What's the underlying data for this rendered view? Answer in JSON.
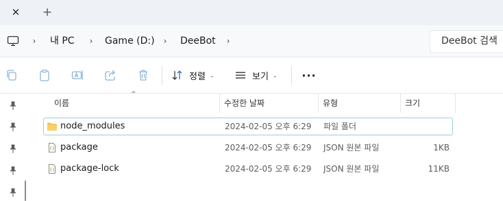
{
  "tabs": {
    "close_glyph": "✕",
    "new_tab_glyph": "+"
  },
  "address": {
    "breadcrumbs": [
      {
        "label": "내 PC"
      },
      {
        "label": "Game (D:)"
      },
      {
        "label": "DeeBot"
      }
    ],
    "separator_glyph": "›",
    "search_placeholder": "DeeBot 검색"
  },
  "toolbar": {
    "sort_label": "정렬",
    "view_label": "보기",
    "caret_glyph": "⌄",
    "more_glyph": "···"
  },
  "columns": {
    "name": "이름",
    "modified": "수정한 날짜",
    "type": "유형",
    "size": "크기"
  },
  "files": [
    {
      "name": "node_modules",
      "modified": "2024-02-05 오후 6:29",
      "type": "파일 폴더",
      "size": "",
      "icon": "folder-icon",
      "selected": true
    },
    {
      "name": "package",
      "modified": "2024-02-05 오후 6:29",
      "type": "JSON 원본 파일",
      "size": "1KB",
      "icon": "json-file-icon",
      "selected": false
    },
    {
      "name": "package-lock",
      "modified": "2024-02-05 오후 6:29",
      "type": "JSON 원본 파일",
      "size": "11KB",
      "icon": "json-file-icon",
      "selected": false
    }
  ],
  "colors": {
    "folder": "#f2c14e",
    "selection_border": "#95d1d9",
    "accent_toolbar_icon": "#8ab4d8"
  }
}
